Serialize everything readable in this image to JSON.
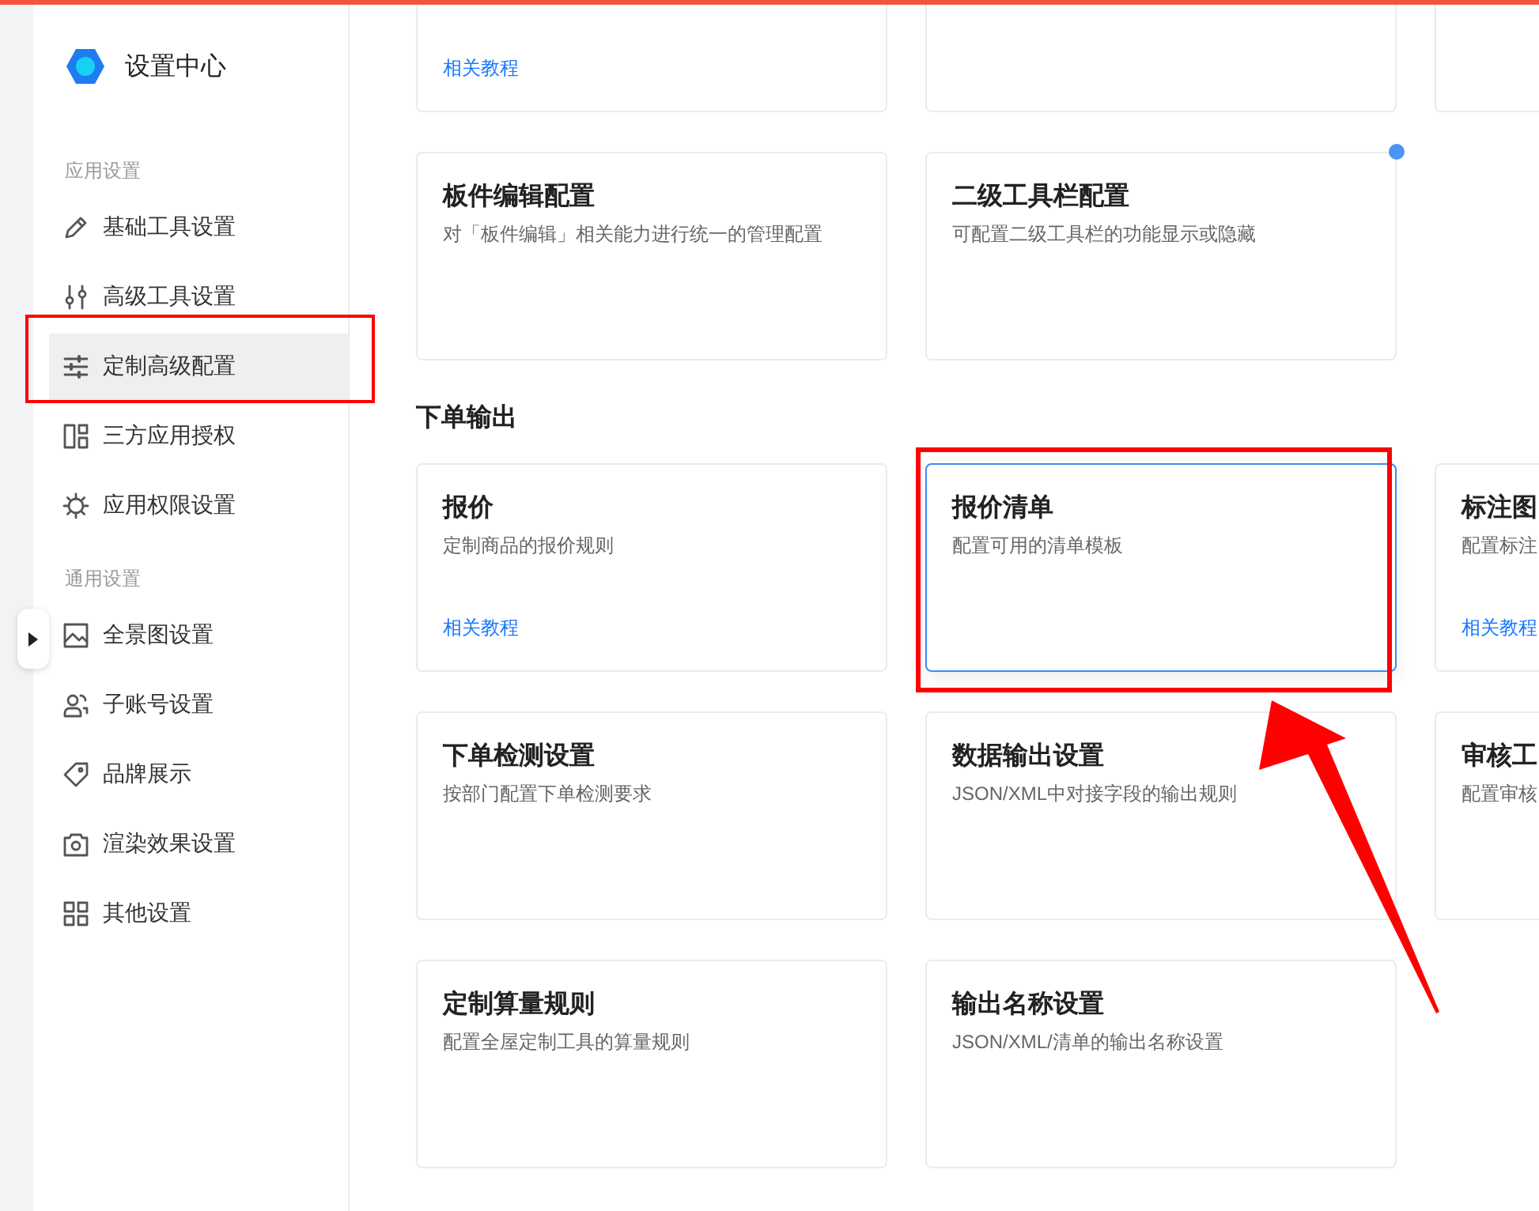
{
  "sidebar": {
    "title": "设置中心",
    "groups": [
      {
        "label": "应用设置",
        "items": [
          {
            "label": "基础工具设置",
            "selected": false,
            "annotated": false
          },
          {
            "label": "高级工具设置",
            "selected": false,
            "annotated": false
          },
          {
            "label": "定制高级配置",
            "selected": true,
            "annotated": true
          },
          {
            "label": "三方应用授权",
            "selected": false,
            "annotated": false
          },
          {
            "label": "应用权限设置",
            "selected": false,
            "annotated": false
          }
        ]
      },
      {
        "label": "通用设置",
        "items": [
          {
            "label": "全景图设置",
            "selected": false,
            "annotated": false
          },
          {
            "label": "子账号设置",
            "selected": false,
            "annotated": false
          },
          {
            "label": "品牌展示",
            "selected": false,
            "annotated": false
          },
          {
            "label": "渲染效果设置",
            "selected": false,
            "annotated": false
          },
          {
            "label": "其他设置",
            "selected": false,
            "annotated": false
          }
        ]
      }
    ]
  },
  "sections": [
    {
      "rows": [
        [
          {
            "link": "相关教程",
            "selected": false
          },
          {
            "selected": false
          },
          {
            "selected": false
          }
        ],
        [
          {
            "title": "板件编辑配置",
            "description": "对「板件编辑」相关能力进行统一的管理配置",
            "selected": false,
            "annotated": false,
            "badge": false
          },
          {
            "title": "二级工具栏配置",
            "description": "可配置二级工具栏的功能显示或隐藏",
            "selected": false,
            "annotated": false,
            "badge": true
          }
        ]
      ]
    },
    {
      "title": "下单输出",
      "rows": [
        [
          {
            "title": "报价",
            "description": "定制商品的报价规则",
            "link": "相关教程",
            "selected": false,
            "annotated": false,
            "badge": false
          },
          {
            "title": "报价清单",
            "description": "配置可用的清单模板",
            "selected": true,
            "annotated": true,
            "badge": false
          },
          {
            "title": "标注图",
            "description": "配置标注",
            "link": "相关教程",
            "selected": false
          }
        ],
        [
          {
            "title": "下单检测设置",
            "description": "按部门配置下单检测要求",
            "selected": false,
            "annotated": false,
            "badge": false
          },
          {
            "title": "数据输出设置",
            "description": "JSON/XML中对接字段的输出规则",
            "selected": false,
            "annotated": false,
            "badge": false
          },
          {
            "title": "审核工",
            "description": "配置审核",
            "selected": false
          }
        ],
        [
          {
            "title": "定制算量规则",
            "description": "配置全屋定制工具的算量规则",
            "selected": false,
            "annotated": false,
            "badge": false
          },
          {
            "title": "输出名称设置",
            "description": "JSON/XML/清单的输出名称设置",
            "selected": false,
            "annotated": false,
            "badge": false
          }
        ]
      ]
    }
  ]
}
